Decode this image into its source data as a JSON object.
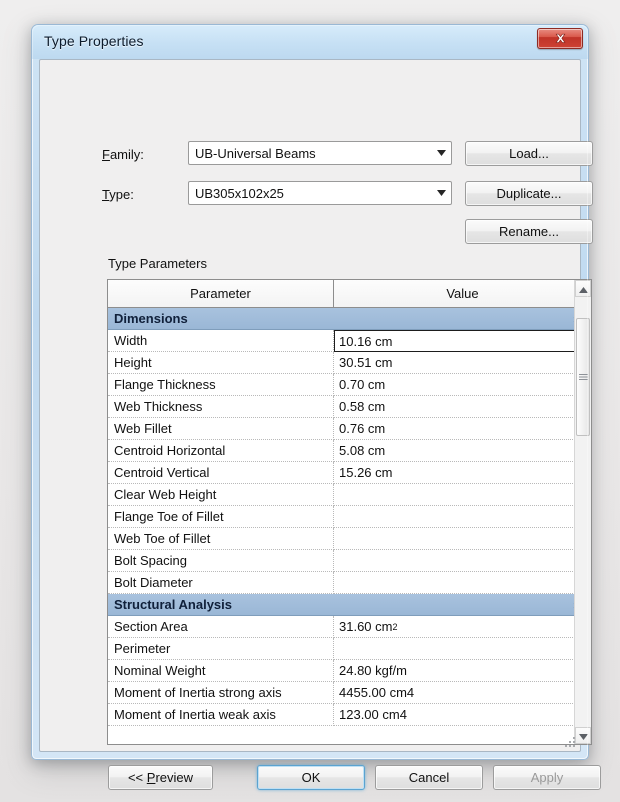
{
  "window": {
    "title": "Type Properties",
    "close_icon": "close-x-icon"
  },
  "form": {
    "family_label": "Family:",
    "family_value": "UB-Universal Beams",
    "type_label": "Type:",
    "type_value": "UB305x102x25",
    "dropdown_icon": "chevron-down-icon",
    "load_label": "Load...",
    "duplicate_label": "Duplicate...",
    "rename_label": "Rename..."
  },
  "grid": {
    "caption": "Type Parameters",
    "columns": [
      "Parameter",
      "Value"
    ],
    "collapse_icon": "double-chevron-up-icon",
    "sections": [
      {
        "name": "Dimensions",
        "rows": [
          {
            "parameter": "Width",
            "value": "10.16 cm",
            "active": true
          },
          {
            "parameter": "Height",
            "value": "30.51 cm"
          },
          {
            "parameter": "Flange Thickness",
            "value": "0.70 cm"
          },
          {
            "parameter": "Web Thickness",
            "value": "0.58 cm"
          },
          {
            "parameter": "Web Fillet",
            "value": "0.76 cm"
          },
          {
            "parameter": "Centroid Horizontal",
            "value": "5.08 cm"
          },
          {
            "parameter": "Centroid Vertical",
            "value": "15.26 cm"
          },
          {
            "parameter": "Clear Web Height",
            "value": ""
          },
          {
            "parameter": "Flange Toe of Fillet",
            "value": ""
          },
          {
            "parameter": "Web Toe of Fillet",
            "value": ""
          },
          {
            "parameter": "Bolt Spacing",
            "value": ""
          },
          {
            "parameter": "Bolt Diameter",
            "value": ""
          }
        ]
      },
      {
        "name": "Structural Analysis",
        "rows": [
          {
            "parameter": "Section Area",
            "value": "31.60 cm",
            "superscript": "2"
          },
          {
            "parameter": "Perimeter",
            "value": ""
          },
          {
            "parameter": "Nominal Weight",
            "value": "24.80 kgf/m"
          },
          {
            "parameter": "Moment of Inertia strong axis",
            "value": "4455.00 cm4"
          },
          {
            "parameter": "Moment of Inertia weak axis",
            "value": "123.00 cm4"
          }
        ]
      }
    ],
    "scrollbar": {
      "up_icon": "triangle-up-icon",
      "down_icon": "triangle-down-icon",
      "thumb_grip_icon": "grip-lines-icon"
    }
  },
  "footer": {
    "preview_label": "<< Preview",
    "ok_label": "OK",
    "cancel_label": "Cancel",
    "apply_label": "Apply",
    "resize_grip_icon": "resize-grip-icon"
  },
  "colors": {
    "title_bar": "#c6e0f4",
    "section_header": "#9ab7d6",
    "close_button": "#bf3328",
    "default_button_focus": "#5ba3d0"
  }
}
